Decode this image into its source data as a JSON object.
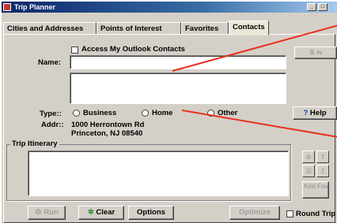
{
  "window": {
    "title": "Trip Planner"
  },
  "title_buttons": {
    "minimize": "_",
    "maximize": "□"
  },
  "tabs": [
    {
      "label": "Cities and Addresses"
    },
    {
      "label": "Points of Interest"
    },
    {
      "label": "Favorites"
    },
    {
      "label": "Contacts"
    }
  ],
  "contacts": {
    "outlook_label": "Access My Outlook Contacts",
    "name_label": "Name:",
    "name_value": "",
    "type_label": "Type::",
    "types": [
      {
        "label": "Business"
      },
      {
        "label": "Home"
      },
      {
        "label": "Other"
      }
    ],
    "addr_label": "Addr::",
    "addr_line1": "1000 Herrontown Rd",
    "addr_line2": "Princeton, NJ 08540"
  },
  "buttons": {
    "help": "Help",
    "add_fav": "Add Fav",
    "run": "Run",
    "clear": "Clear",
    "options": "Options",
    "optimize": "Optimize",
    "round_trip": "Round Trip"
  },
  "itinerary": {
    "title": "Trip Itinerary"
  },
  "accent": {
    "callout_line": "#e8301e",
    "title_bar": "#0a246a"
  }
}
